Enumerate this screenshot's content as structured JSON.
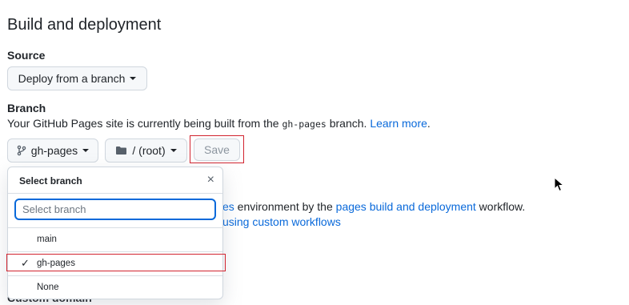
{
  "section": {
    "title": "Build and deployment"
  },
  "source": {
    "label": "Source",
    "dropdown_value": "Deploy from a branch"
  },
  "branch": {
    "label": "Branch",
    "description_prefix": "Your GitHub Pages site is currently being built from the ",
    "branch_code": "gh-pages",
    "description_suffix": " branch. ",
    "learn_more": "Learn more",
    "description_end": ".",
    "branch_button": "gh-pages",
    "folder_button": "/ (root)",
    "save_button": "Save"
  },
  "background_text": {
    "line1_link_fragment": "es",
    "line1_mid": " environment by the ",
    "line1_link": "pages build and deployment",
    "line1_end": " workflow.",
    "line2_link": "using custom workflows",
    "peek_text": "Custom domain"
  },
  "branch_menu": {
    "title": "Select branch",
    "close_icon": "×",
    "filter_placeholder": "Select branch",
    "items": [
      {
        "label": "main",
        "selected": false
      },
      {
        "label": "gh-pages",
        "selected": true
      },
      {
        "label": "None",
        "selected": false
      }
    ],
    "check_glyph": "✓"
  },
  "colors": {
    "link": "#0969da",
    "highlight": "#d1242f",
    "focus": "#0969da"
  }
}
